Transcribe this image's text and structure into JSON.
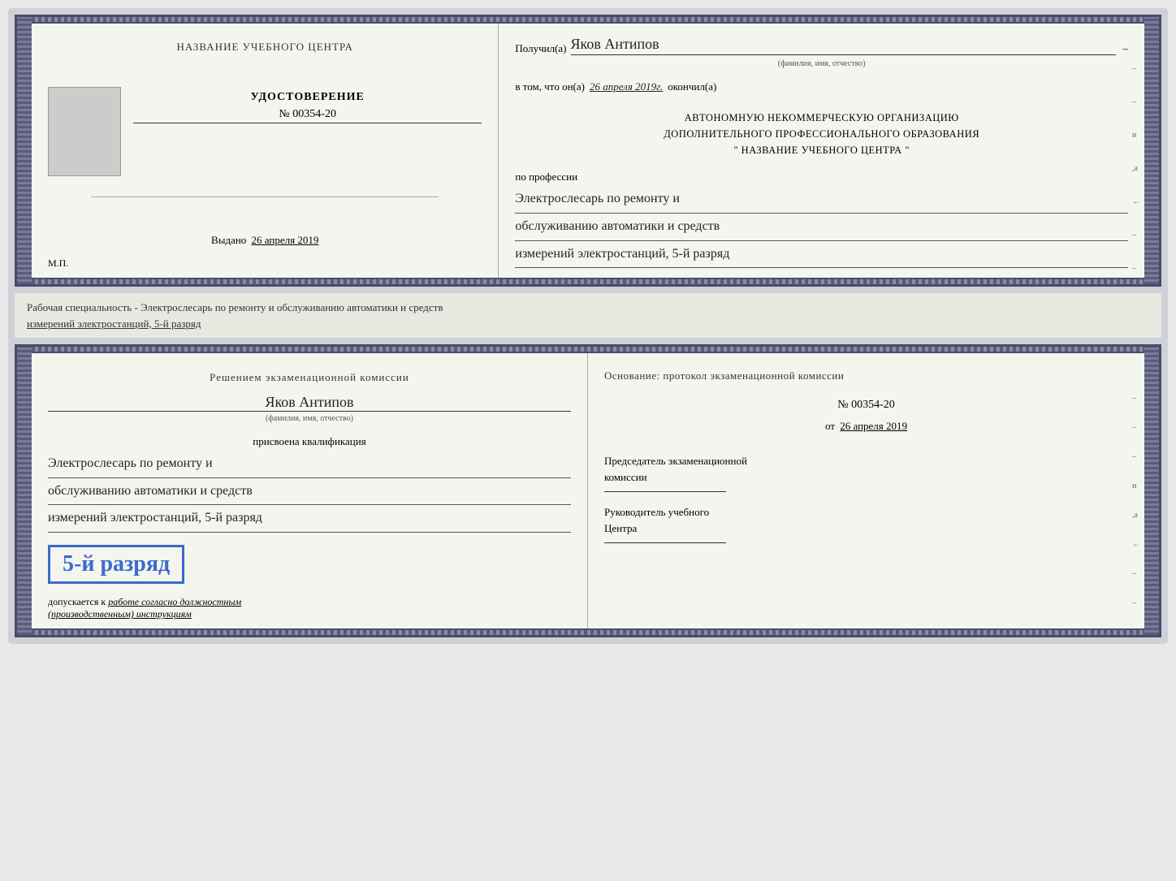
{
  "top_document": {
    "left_panel": {
      "center_name": "НАЗВАНИЕ УЧЕБНОГО ЦЕНТРА",
      "cert_title": "УДОСТОВЕРЕНИЕ",
      "cert_number": "№ 00354-20",
      "vydano_label": "Выдано",
      "vydano_date": "26 апреля 2019",
      "mp_label": "М.П."
    },
    "right_panel": {
      "poluchil_label": "Получил(а)",
      "name_value": "Яков Антипов",
      "fio_subtitle": "(фамилия, имя, отчество)",
      "vtom_label": "в том, что он(а)",
      "date_value": "26 апреля 2019г.",
      "okonchil_label": "окончил(а)",
      "org_line1": "АВТОНОМНУЮ НЕКОММЕРЧЕСКУЮ ОРГАНИЗАЦИЮ",
      "org_line2": "ДОПОЛНИТЕЛЬНОГО ПРОФЕССИОНАЛЬНОГО ОБРАЗОВАНИЯ",
      "org_quotes_open": "\"",
      "org_center_name": "НАЗВАНИЕ УЧЕБНОГО ЦЕНТРА",
      "org_quotes_close": "\"",
      "po_professii": "по профессии",
      "profession_line1": "Электрослесарь по ремонту и",
      "profession_line2": "обслуживанию автоматики и средств",
      "profession_line3": "измерений электростанций, 5-й разряд"
    }
  },
  "middle_text": {
    "line1": "Рабочая специальность - Электрослесарь по ремонту и обслуживанию автоматики и средств",
    "line2": "измерений электростанций, 5-й разряд"
  },
  "bottom_document": {
    "left_panel": {
      "resheniem_label": "Решением экзаменационной комиссии",
      "name_value": "Яков Антипов",
      "fio_subtitle": "(фамилия, имя, отчество)",
      "prisvoena_label": "присвоена квалификация",
      "profession_line1": "Электрослесарь по ремонту и",
      "profession_line2": "обслуживанию автоматики и средств",
      "profession_line3": "измерений электростанций, 5-й разряд",
      "razryad_badge": "5-й разряд",
      "dopuskaetsya_label": "допускается к",
      "dopuskaetsya_text": "работе согласно должностным",
      "dopuskaetsya_text2": "(производственным) инструкциям"
    },
    "right_panel": {
      "osnovanie_label": "Основание: протокол экзаменационной комиссии",
      "protocol_number": "№ 00354-20",
      "ot_label": "от",
      "ot_date": "26 апреля 2019",
      "predsedatel_title": "Председатель экзаменационной",
      "predsedatel_subtitle": "комиссии",
      "rukovoditel_title": "Руководитель учебного",
      "rukovoditel_subtitle": "Центра"
    }
  }
}
